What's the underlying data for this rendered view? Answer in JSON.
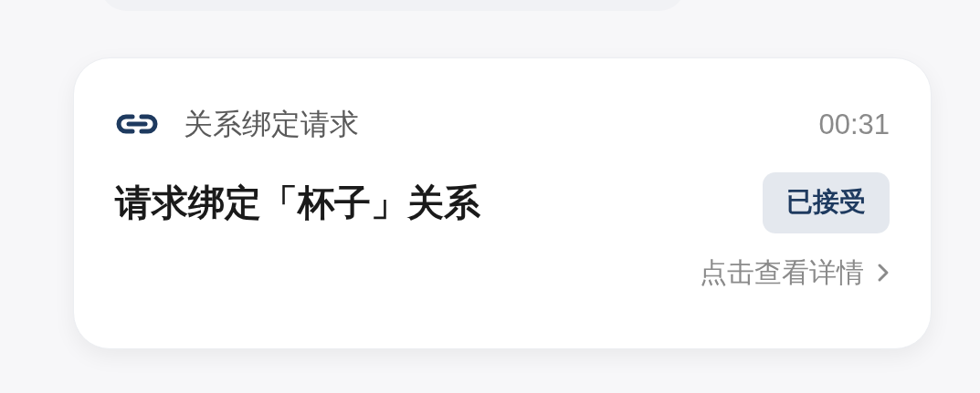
{
  "request_card": {
    "category": "关系绑定请求",
    "time": "00:31",
    "title": "请求绑定「杯子」关系",
    "status": "已接受",
    "details_link": "点击查看详情"
  }
}
